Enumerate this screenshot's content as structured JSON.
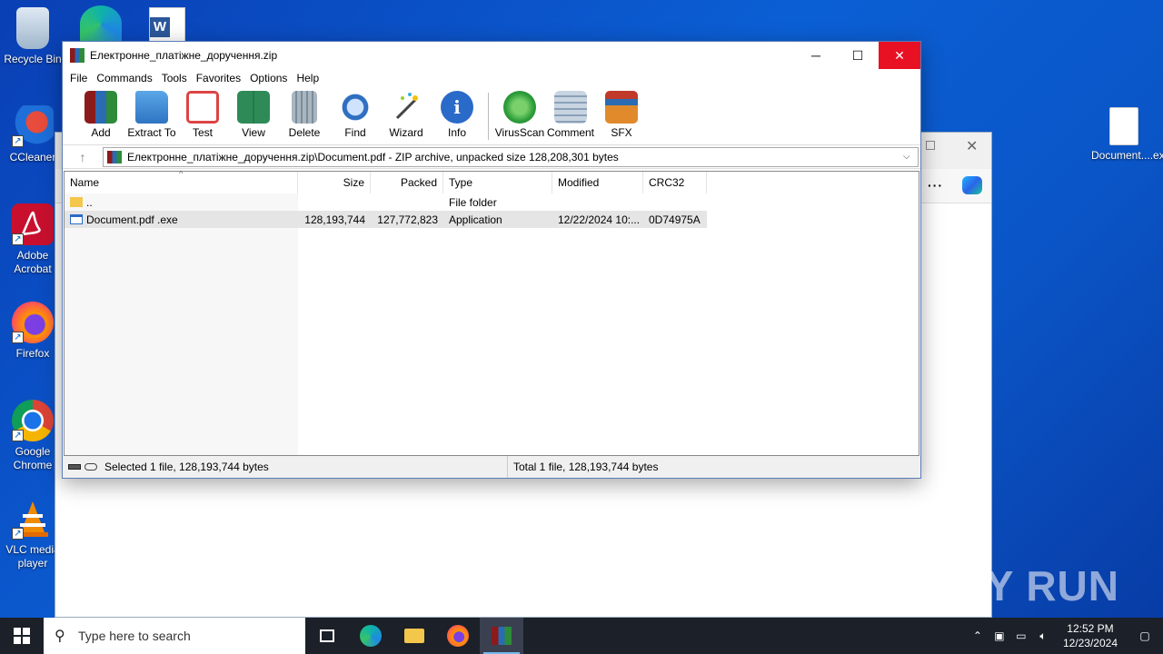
{
  "desktop": {
    "icons": [
      {
        "label": "Recycle Bin",
        "icon": "recycle-bin-icon"
      },
      {
        "label": "CCleaner",
        "icon": "ccleaner-icon"
      },
      {
        "label": "Adobe Acrobat",
        "icon": "adobe-acrobat-icon"
      },
      {
        "label": "Firefox",
        "icon": "firefox-icon"
      },
      {
        "label": "Google Chrome",
        "icon": "chrome-icon"
      },
      {
        "label": "VLC media player",
        "icon": "vlc-icon"
      }
    ],
    "right_icon": {
      "label": "Document....exe",
      "icon": "document-file-icon"
    },
    "watermark": "ANY RUN"
  },
  "window": {
    "title": "Електронне_платіжне_доручення.zip",
    "minimize": "─",
    "maximize": "☐",
    "close": "✕"
  },
  "menu": [
    "File",
    "Commands",
    "Tools",
    "Favorites",
    "Options",
    "Help"
  ],
  "toolbar": [
    {
      "label": "Add",
      "icon": "add-archive-icon",
      "color": "#c0392b"
    },
    {
      "label": "Extract To",
      "icon": "extract-folder-icon",
      "color": "#3b82c4"
    },
    {
      "label": "Test",
      "icon": "test-clipboard-icon",
      "color": "#d44"
    },
    {
      "label": "View",
      "icon": "view-book-icon",
      "color": "#2e8b57"
    },
    {
      "label": "Delete",
      "icon": "delete-trash-icon",
      "color": "#8a9aa8"
    },
    {
      "label": "Find",
      "icon": "find-magnifier-icon",
      "color": "#2f6fc0"
    },
    {
      "label": "Wizard",
      "icon": "wizard-wand-icon",
      "color": "#9acd32"
    },
    {
      "label": "Info",
      "icon": "info-icon",
      "color": "#2a6ac8"
    },
    {
      "label": "VirusScan",
      "icon": "virusscan-bug-icon",
      "color": "#2e9e3a"
    },
    {
      "label": "Comment",
      "icon": "comment-icon",
      "color": "#8aa0b8"
    },
    {
      "label": "SFX",
      "icon": "sfx-box-icon",
      "color": "#e08a2c"
    }
  ],
  "path": {
    "text": "Електронне_платіжне_доручення.zip\\Document.pdf  - ZIP archive, unpacked size 128,208,301 bytes"
  },
  "list": {
    "headers": {
      "name": "Name",
      "size": "Size",
      "packed": "Packed",
      "type": "Type",
      "modified": "Modified",
      "crc": "CRC32"
    },
    "rows": [
      {
        "name": "..",
        "size": "",
        "packed": "",
        "type": "File folder",
        "modified": "",
        "crc": "",
        "icon": "folder-icon"
      },
      {
        "name": "Document.pdf .exe",
        "size": "128,193,744",
        "packed": "127,772,823",
        "type": "Application",
        "modified": "12/22/2024 10:...",
        "crc": "0D74975A",
        "icon": "exe-icon"
      }
    ]
  },
  "status": {
    "left": "Selected 1 file, 128,193,744 bytes",
    "right": "Total 1 file, 128,193,744 bytes"
  },
  "taskbar": {
    "search_placeholder": "Type here to search",
    "time": "12:52 PM",
    "date": "12/23/2024"
  }
}
